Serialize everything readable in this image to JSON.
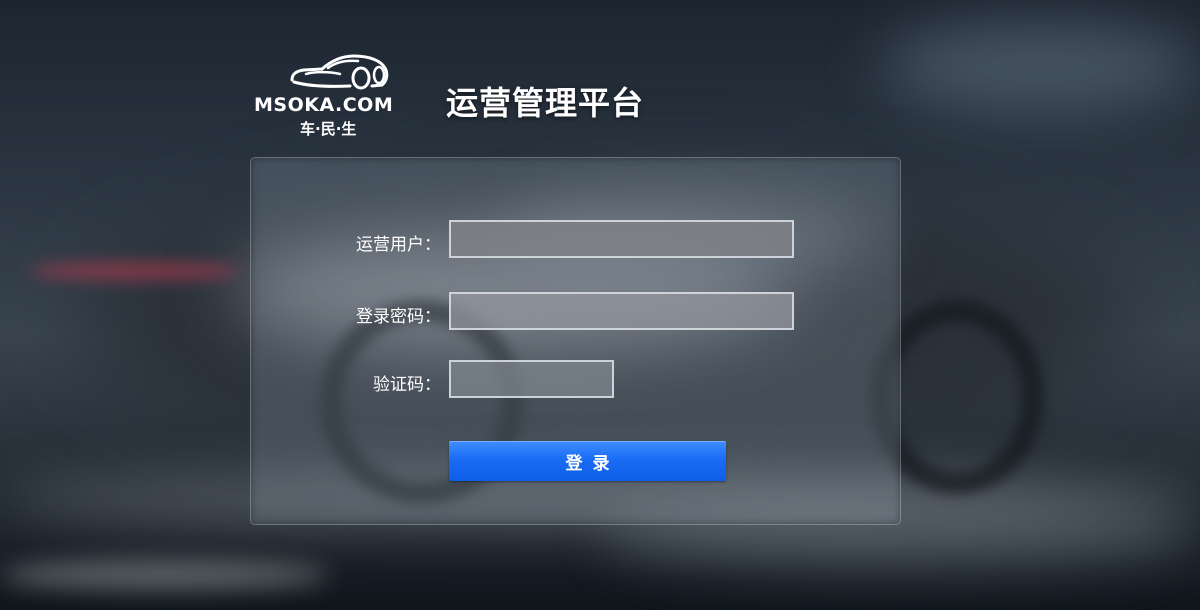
{
  "brand": {
    "logo_icon": "car-outline-icon",
    "name": "MSOKA.COM",
    "subtitle": "车·民·生"
  },
  "header": {
    "title": "运营管理平台"
  },
  "login_form": {
    "user_label": "运营用户：",
    "user_value": "",
    "password_label": "登录密码：",
    "password_value": "",
    "captcha_label": "验证码：",
    "captcha_value": "",
    "submit_label": "登录"
  },
  "colors": {
    "button_primary": "#1a6cf5",
    "text": "#ffffff"
  }
}
